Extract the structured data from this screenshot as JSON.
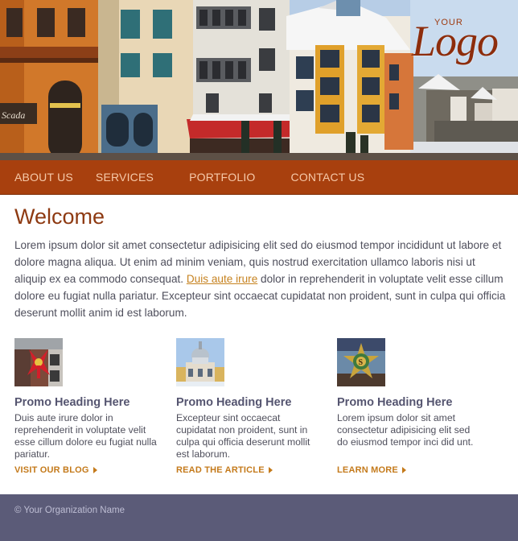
{
  "logo": {
    "small": "YOUR",
    "main": "Logo"
  },
  "nav": {
    "items": [
      "ABOUT US",
      "SERVICES",
      "PORTFOLIO",
      "CONTACT US"
    ]
  },
  "welcome": {
    "title": "Welcome",
    "text_before_link": "Lorem ipsum dolor sit amet consectetur adipisicing elit sed do eiusmod tempor incididunt ut labore et dolore magna aliqua. Ut enim ad minim veniam, quis nostrud exercitation ullamco laboris nisi ut aliquip ex ea commodo consequat. ",
    "link_text": "Duis aute irure",
    "text_after_link": " dolor in reprehenderit in voluptate velit esse cillum dolore eu fugiat nulla pariatur. Excepteur sint occaecat cupidatat non proident, sunt in culpa qui officia deserunt mollit anim id est laborum."
  },
  "promos": [
    {
      "heading": "Promo Heading Here",
      "body": "Duis aute irure dolor in reprehenderit in voluptate velit esse cillum dolore eu fugiat nulla pariatur.",
      "link": "VISIT OUR BLOG"
    },
    {
      "heading": "Promo Heading Here",
      "body": "Excepteur sint occaecat cupidatat non proident, sunt in culpa qui officia deserunt mollit est laborum.",
      "link": "READ THE ARTICLE"
    },
    {
      "heading": "Promo Heading Here",
      "body": "Lorem ipsum dolor sit amet consectetur adipisicing elit sed do eiusmod tempor inci did unt.",
      "link": "LEARN MORE"
    }
  ],
  "footer": {
    "text": "© Your Organization Name"
  },
  "colors": {
    "nav_bg": "#a8400e",
    "nav_text": "#f6c9a9",
    "heading": "#8e3a12",
    "link": "#c6821f",
    "footer_bg": "#5b5b78"
  }
}
